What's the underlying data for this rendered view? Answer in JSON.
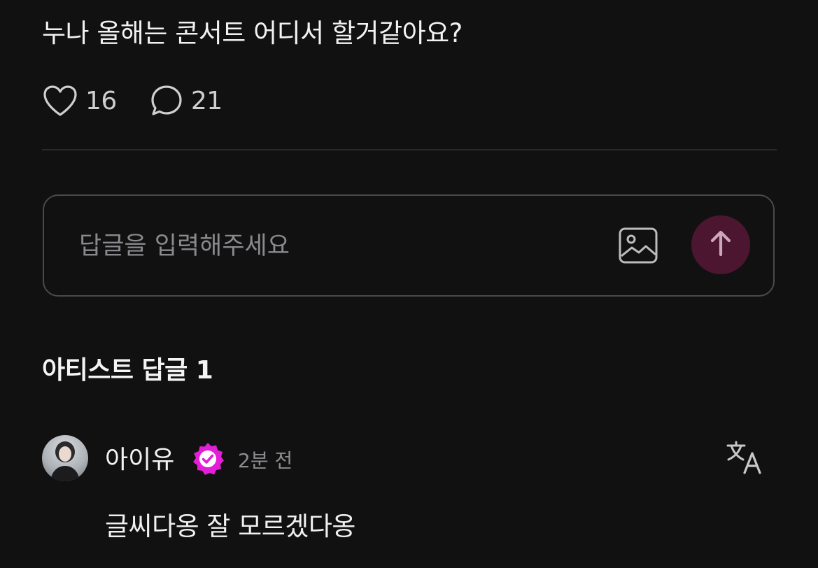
{
  "post": {
    "text": "누나 올해는 콘서트 어디서 할거같아요?",
    "likes": "16",
    "comments": "21"
  },
  "reply": {
    "placeholder": "답글을 입력해주세요",
    "send_color": "#4c1630"
  },
  "artist_replies": {
    "title": "아티스트 답글 1",
    "items": [
      {
        "author": "아이유",
        "time": "2분 전",
        "text": "글씨다옹 잘 모르겠다옹",
        "badge_color": "#e21fd6"
      }
    ]
  },
  "icons": [
    "heart-icon",
    "comment-bubble-icon",
    "image-icon",
    "arrow-up-icon",
    "verified-badge-icon",
    "translate-icon"
  ]
}
